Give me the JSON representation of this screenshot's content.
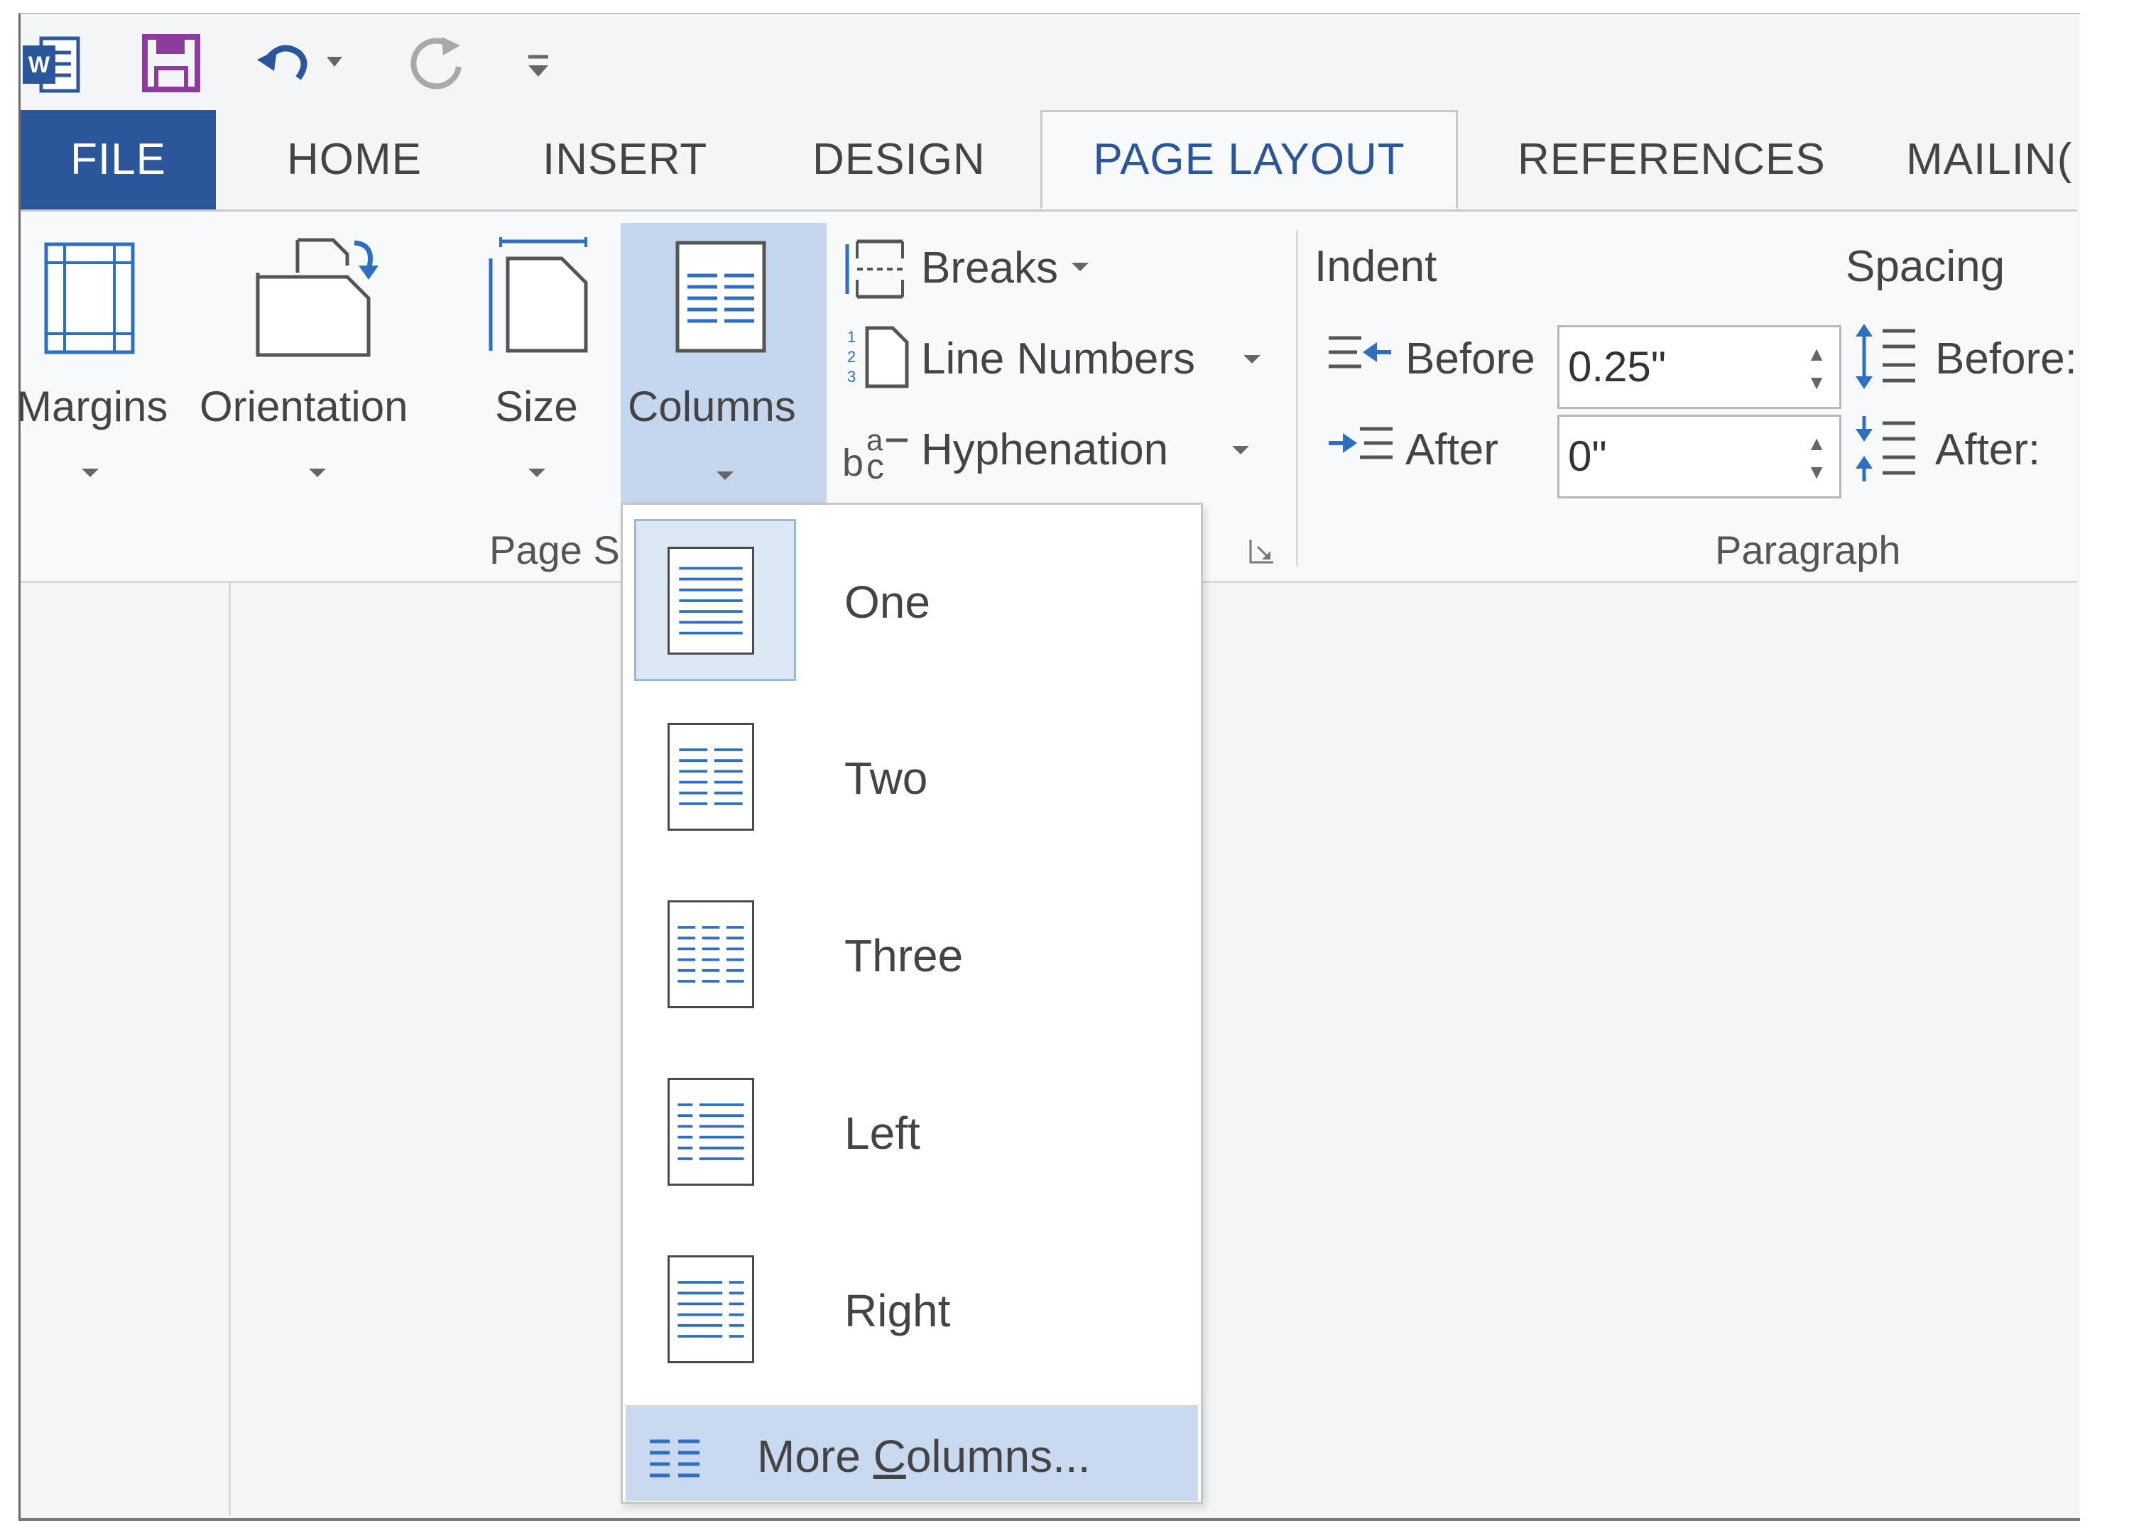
{
  "tabs": [
    {
      "label": "FILE"
    },
    {
      "label": "HOME"
    },
    {
      "label": "INSERT"
    },
    {
      "label": "DESIGN"
    },
    {
      "label": "PAGE LAYOUT"
    },
    {
      "label": "REFERENCES"
    },
    {
      "label": "MAILIN("
    }
  ],
  "ribbon": {
    "page_setup": {
      "margins": "Margins",
      "orientation": "Orientation",
      "size": "Size",
      "columns": "Columns",
      "breaks": "Breaks",
      "line_numbers": "Line Numbers",
      "hyphenation": "Hyphenation",
      "group_label": "Page S"
    },
    "paragraph": {
      "indent_heading": "Indent",
      "spacing_heading": "Spacing",
      "indent_before_label": "Before",
      "indent_before_value": "0.25\"",
      "indent_after_label": "After",
      "indent_after_value": "0\"",
      "spacing_before_label": "Before:",
      "spacing_after_label": "After:",
      "group_label": "Paragraph"
    }
  },
  "columns_menu": {
    "items": [
      {
        "label": "One",
        "selected": true
      },
      {
        "label": "Two",
        "selected": false
      },
      {
        "label": "Three",
        "selected": false
      },
      {
        "label": "Left",
        "selected": false
      },
      {
        "label": "Right",
        "selected": false
      }
    ],
    "more_prefix": "More ",
    "more_accel": "C",
    "more_rest": "olumns..."
  },
  "colors": {
    "file_tab": "#2b579a",
    "accent": "#2b579a",
    "highlight": "#c5d7ee",
    "icon_blue": "#2f6fc1"
  }
}
